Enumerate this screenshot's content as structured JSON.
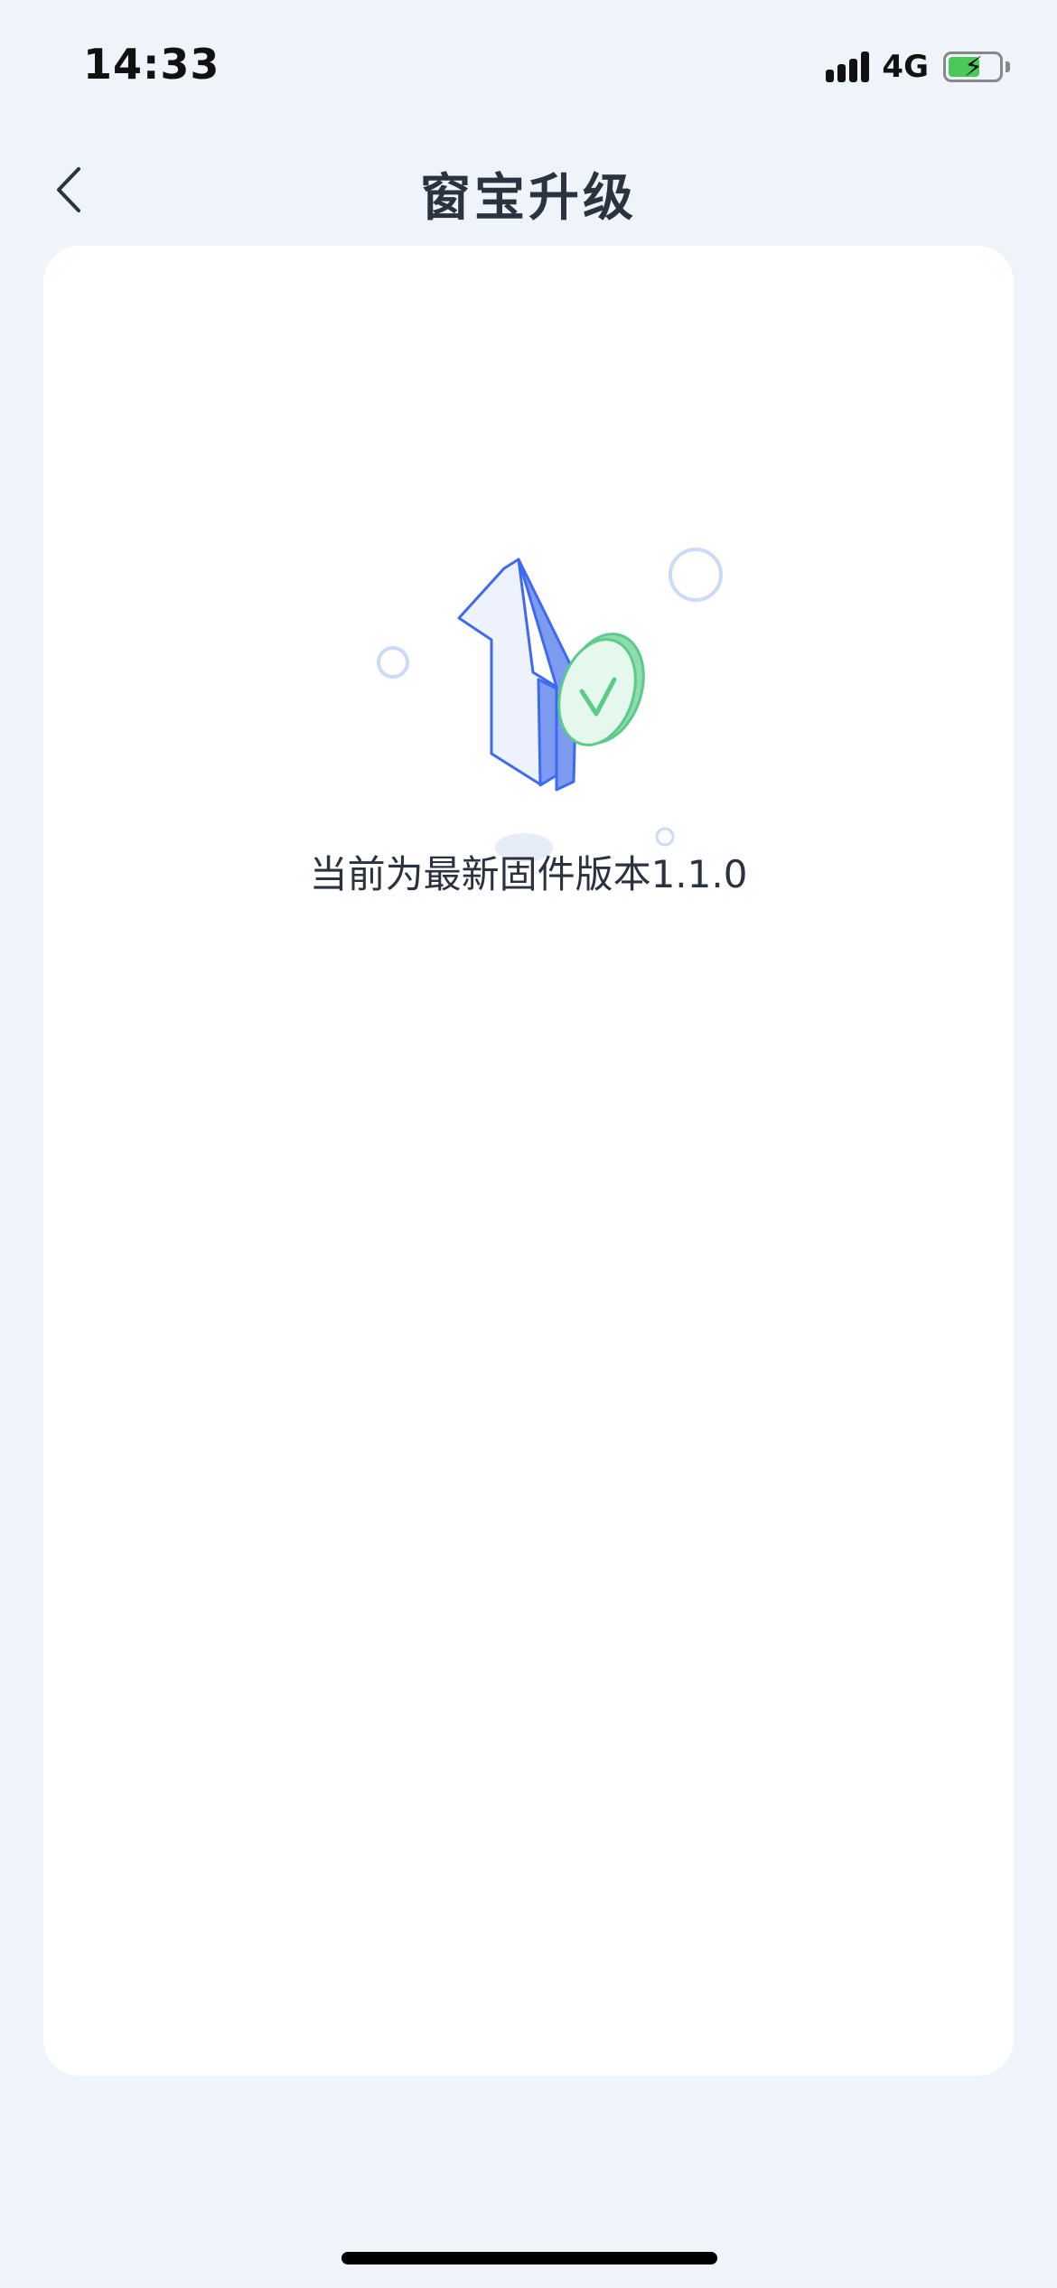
{
  "status_bar": {
    "time": "14:33",
    "network": "4G",
    "icons": [
      "signal-icon",
      "battery-charging-icon"
    ]
  },
  "nav": {
    "title": "窗宝升级",
    "back_icon": "chevron-left-icon"
  },
  "content": {
    "version_message": "当前为最新固件版本1.1.0",
    "illustration_icon": "upgrade-arrow-check-icon"
  },
  "colors": {
    "background": "#EFF3FA",
    "card": "#FFFFFF",
    "title_text": "#2A333F",
    "arrow_blue": "#3D6AF0",
    "check_green": "#5BCB8A",
    "battery_green": "#4CC75A"
  }
}
